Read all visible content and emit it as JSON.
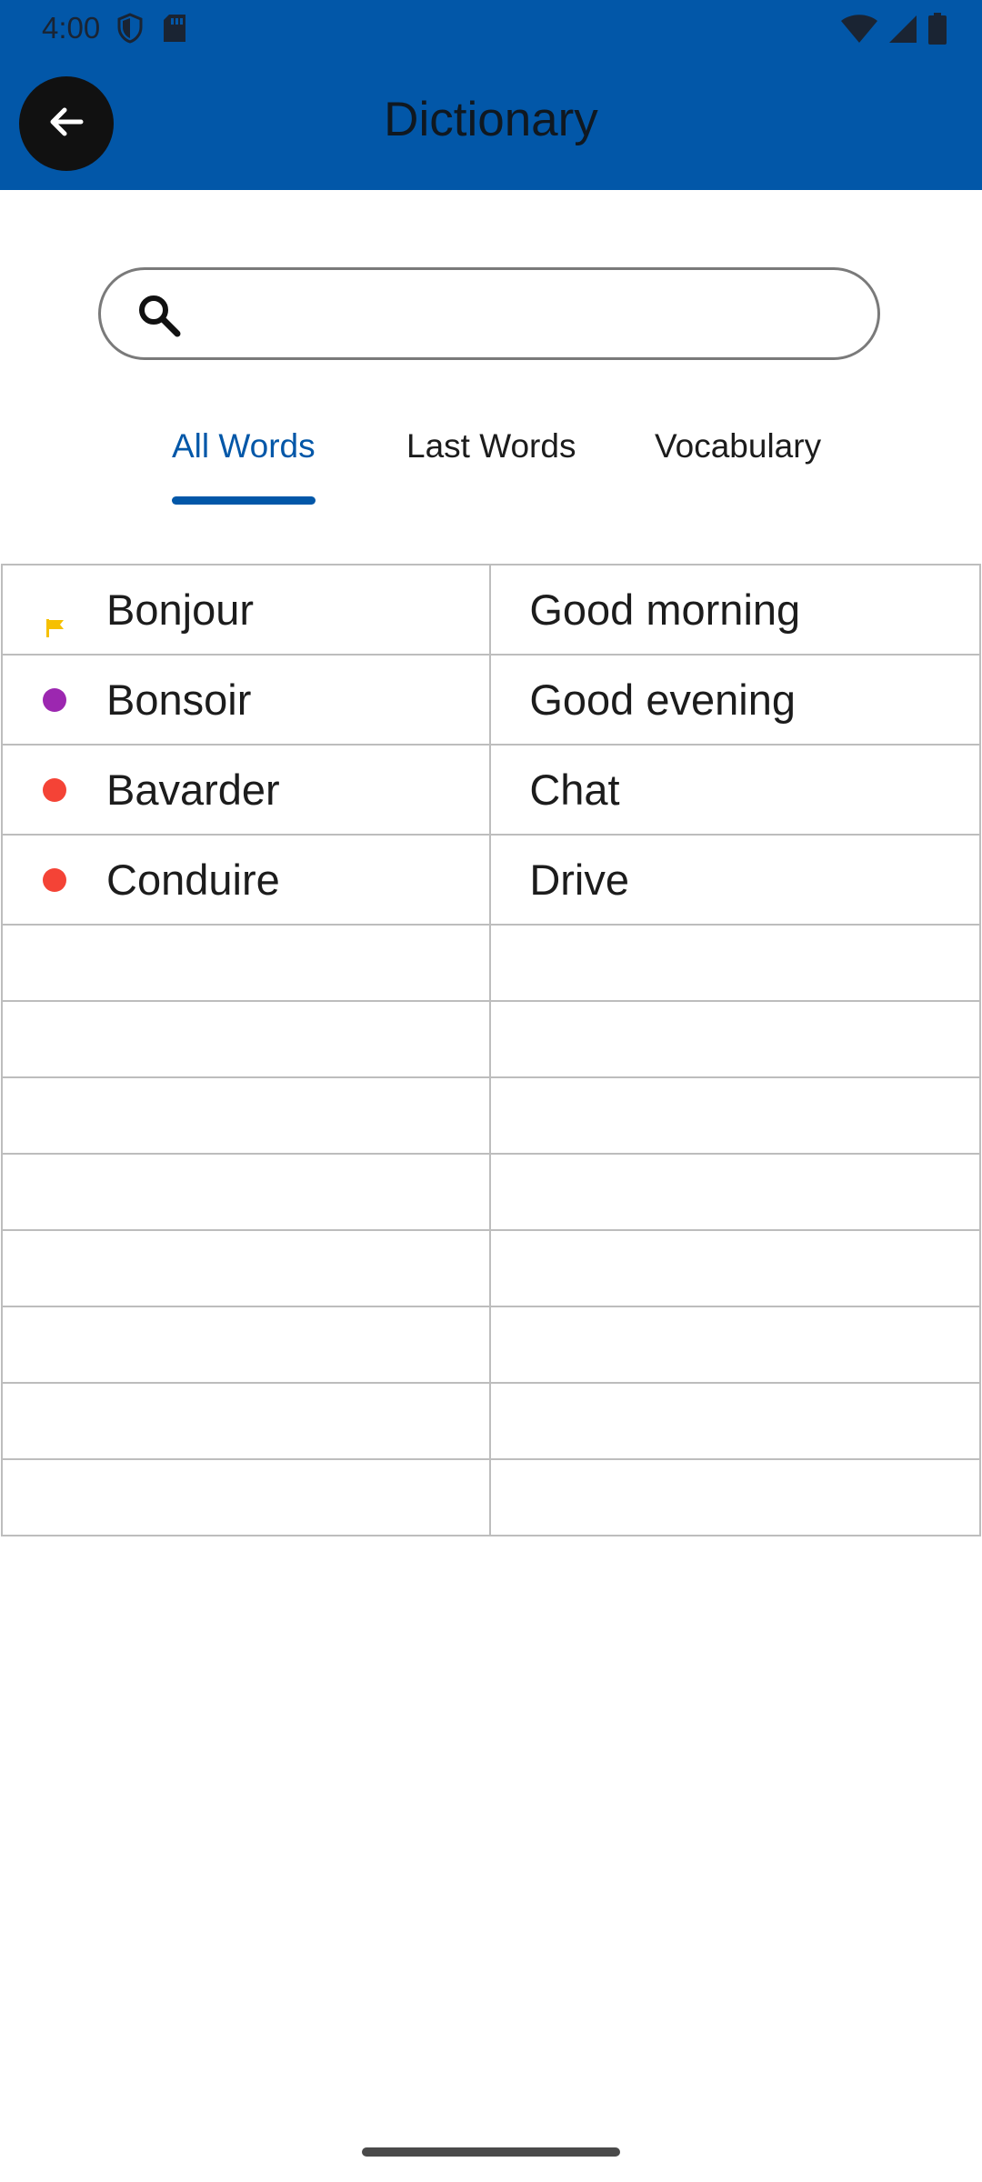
{
  "status_bar": {
    "time": "4:00",
    "icons": [
      "shield-icon",
      "sd-card-icon",
      "wifi-icon",
      "signal-icon",
      "battery-icon"
    ]
  },
  "app_bar": {
    "title": "Dictionary",
    "back_icon": "arrow-back-icon"
  },
  "search": {
    "placeholder": "",
    "value": "",
    "icon": "search-icon"
  },
  "tabs": [
    {
      "label": "All Words",
      "active": true
    },
    {
      "label": "Last Words",
      "active": false
    },
    {
      "label": "Vocabulary",
      "active": false
    }
  ],
  "words": [
    {
      "word": "Bonjour",
      "meaning": "Good morning",
      "marker": "flag",
      "marker_color": "#f6c000"
    },
    {
      "word": "Bonsoir",
      "meaning": "Good evening",
      "marker": "dot",
      "marker_color": "#9c27b0"
    },
    {
      "word": "Bavarder",
      "meaning": "Chat",
      "marker": "dot",
      "marker_color": "#f44336"
    },
    {
      "word": "Conduire",
      "meaning": "Drive",
      "marker": "dot",
      "marker_color": "#f44336"
    }
  ],
  "empty_rows": 8,
  "colors": {
    "primary": "#0257a8",
    "text": "#1c1c1c",
    "grid": "#bdbdbd"
  }
}
